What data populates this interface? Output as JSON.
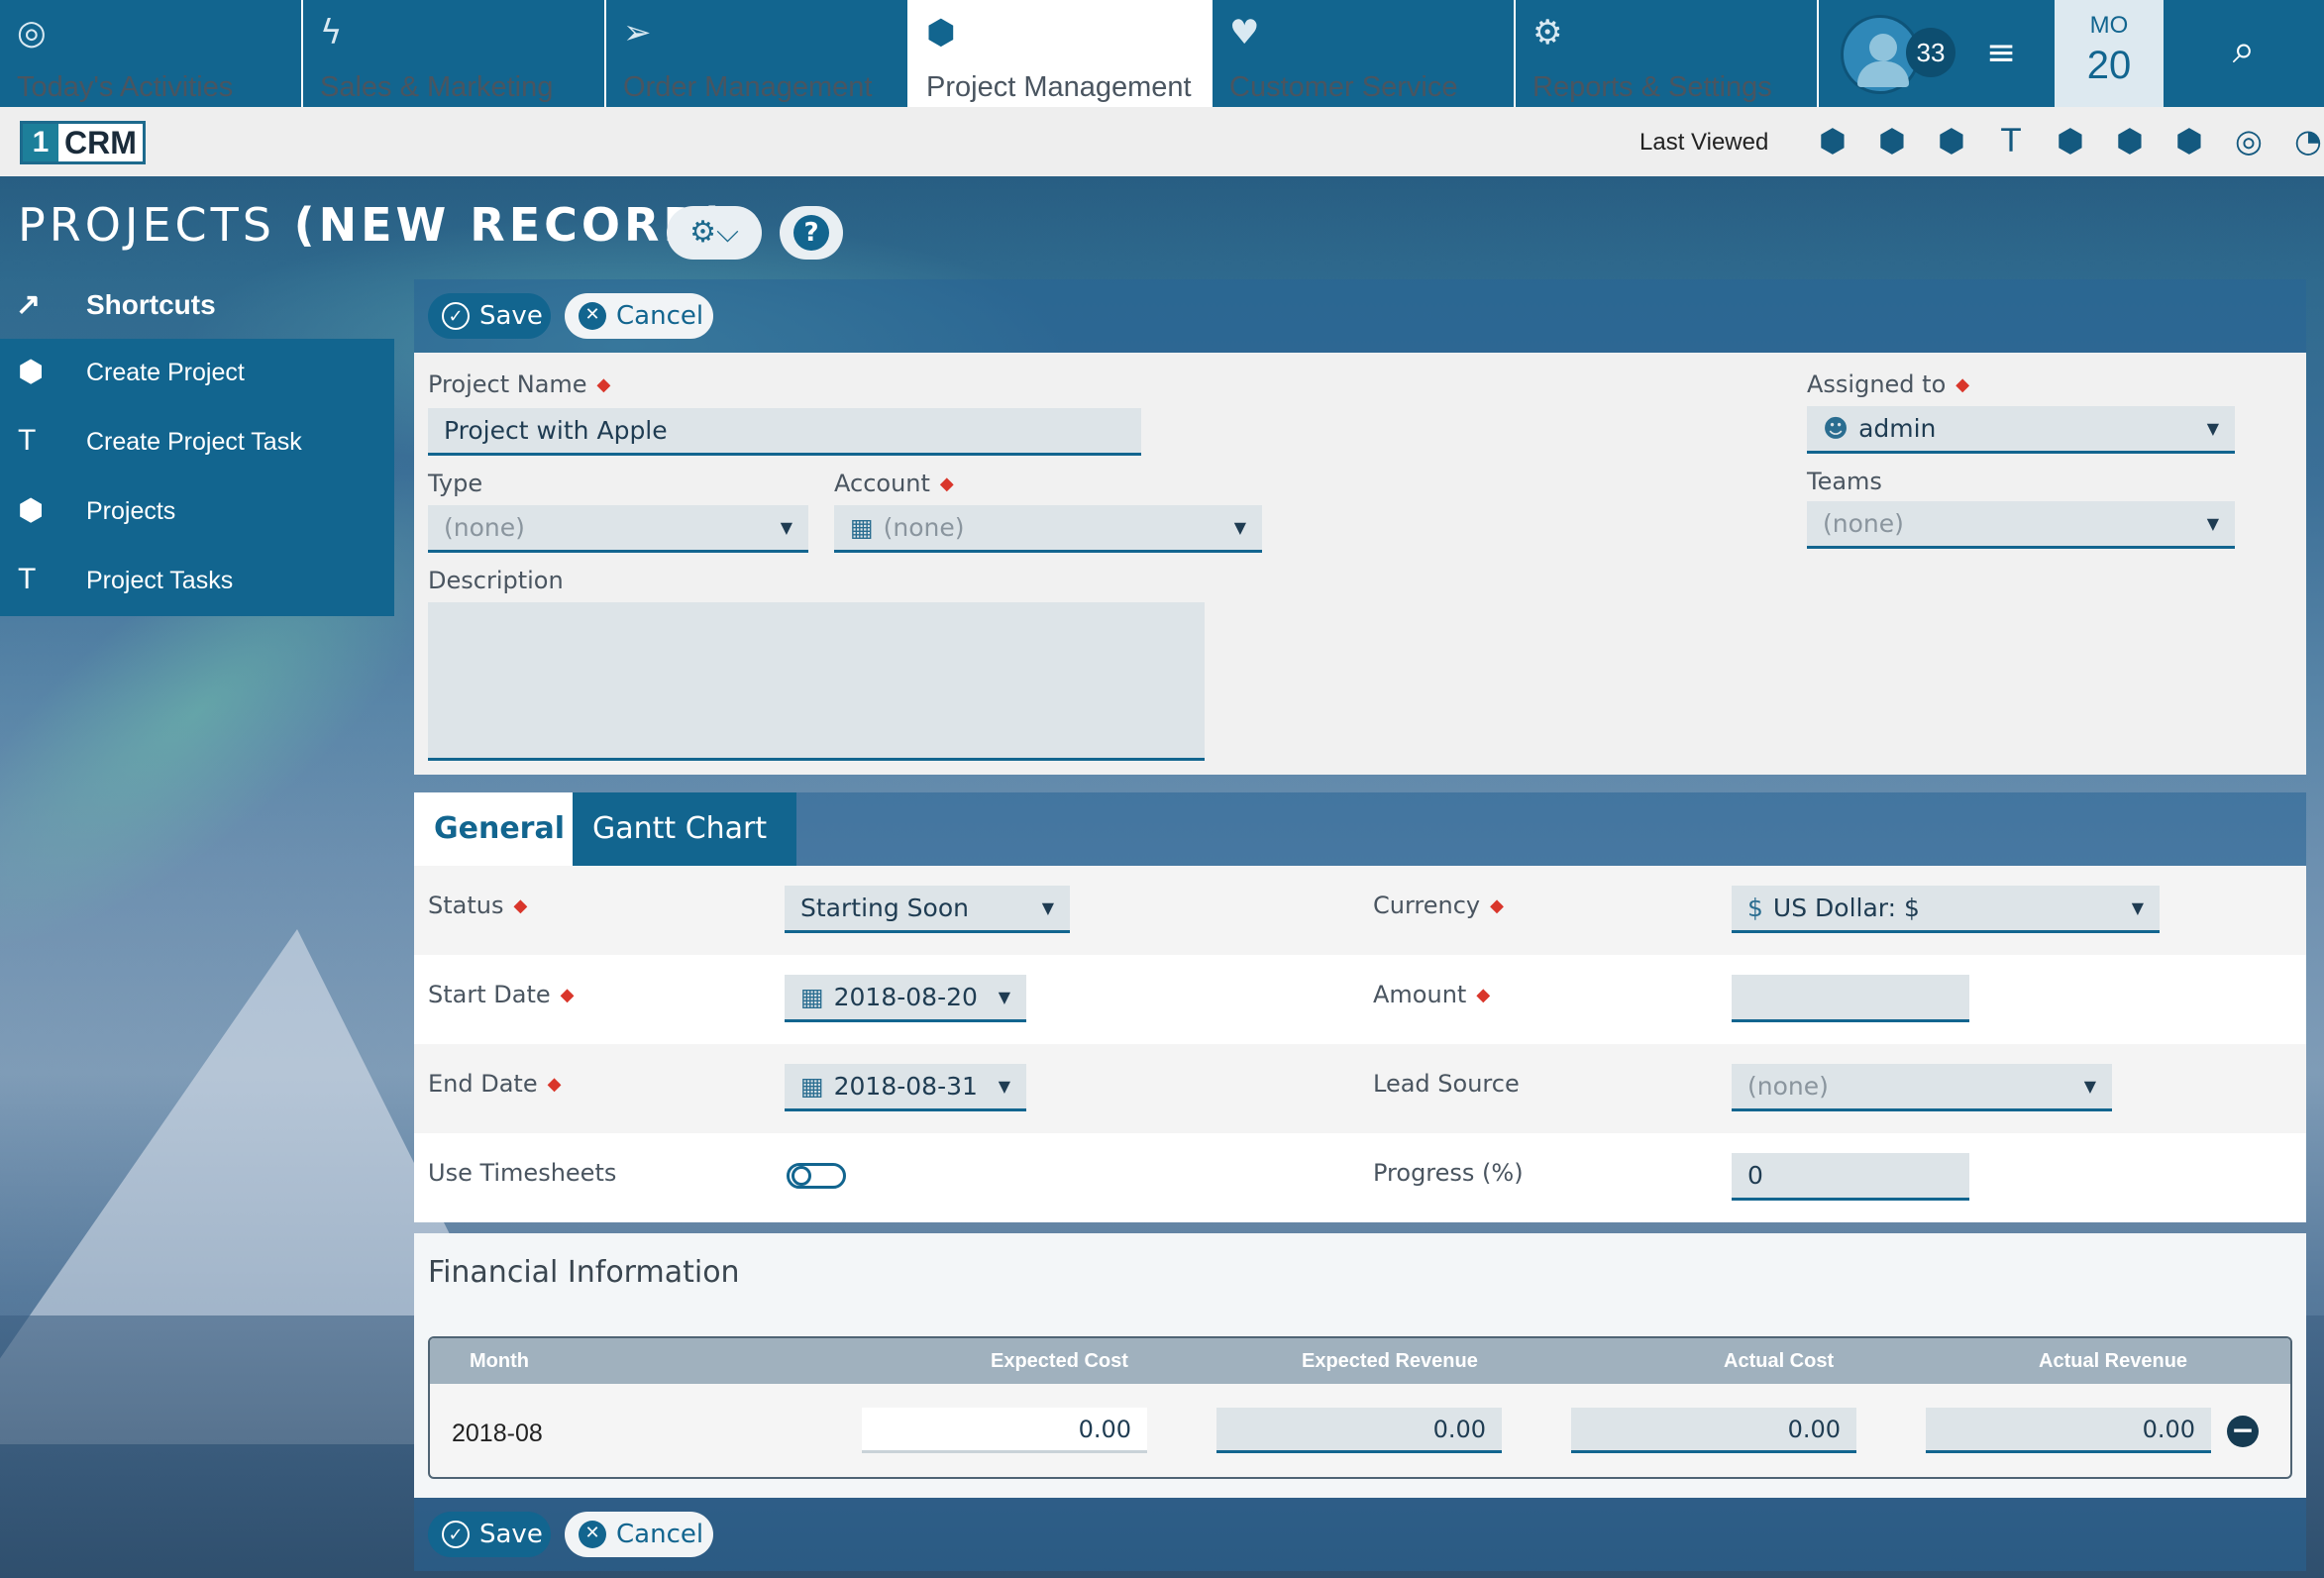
{
  "topnav": {
    "tabs": [
      {
        "label": "Today's Activities",
        "icon": "globe-icon",
        "glyph": "◎"
      },
      {
        "label": "Sales & Marketing",
        "icon": "bolt-icon",
        "glyph": "ϟ"
      },
      {
        "label": "Order Management",
        "icon": "paper-plane-icon",
        "glyph": "➢"
      },
      {
        "label": "Project Management",
        "icon": "cube-icon",
        "glyph": "⬢"
      },
      {
        "label": "Customer Service",
        "icon": "heart-icon",
        "glyph": "♥"
      },
      {
        "label": "Reports & Settings",
        "icon": "gear-icon",
        "glyph": "⚙"
      }
    ],
    "active_tab": "Project Management",
    "notification_count": "33",
    "calendar_month": "MO",
    "calendar_day": "20",
    "menu_glyph": "≡",
    "search_glyph": "⌕"
  },
  "secondbar": {
    "logo_one": "1",
    "logo_crm": "CRM",
    "last_viewed_label": "Last Viewed",
    "last_viewed_icons": [
      "cube-icon",
      "cube-icon",
      "cube-icon",
      "task-icon",
      "cube-icon",
      "cube-icon",
      "cube-icon",
      "soccer-ball-icon",
      "pie-icon"
    ],
    "last_viewed_glyphs": [
      "⬢",
      "⬢",
      "⬢",
      "T",
      "⬢",
      "⬢",
      "⬢",
      "◎",
      "◔"
    ]
  },
  "page": {
    "title_prefix": "PROJECTS",
    "title_suffix": "(NEW RECORD)",
    "gear_glyph": "⚙⌵",
    "help_glyph": "?"
  },
  "sidebar": {
    "header": "Shortcuts",
    "header_glyph": "↗",
    "items": [
      {
        "label": "Create Project",
        "icon": "cube-icon",
        "glyph": "⬢"
      },
      {
        "label": "Create Project Task",
        "icon": "task-icon",
        "glyph": "T"
      },
      {
        "label": "Projects",
        "icon": "cube-icon",
        "glyph": "⬢"
      },
      {
        "label": "Project Tasks",
        "icon": "task-icon",
        "glyph": "T"
      }
    ]
  },
  "actions": {
    "save_label": "Save",
    "cancel_label": "Cancel",
    "save_glyph": "✓",
    "cancel_glyph": "✕"
  },
  "form": {
    "project_name_label": "Project Name",
    "project_name_value": "Project with Apple",
    "assigned_to_label": "Assigned to",
    "assigned_to_value": "admin",
    "type_label": "Type",
    "type_value": "(none)",
    "account_label": "Account",
    "account_value": "(none)",
    "teams_label": "Teams",
    "teams_value": "(none)",
    "description_label": "Description",
    "description_value": ""
  },
  "tabs": {
    "general": "General",
    "gantt": "Gantt Chart"
  },
  "general": {
    "status_label": "Status",
    "status_value": "Starting Soon",
    "currency_label": "Currency",
    "currency_value": "US Dollar: $",
    "start_date_label": "Start Date",
    "start_date_value": "2018-08-20",
    "amount_label": "Amount",
    "amount_value": "",
    "end_date_label": "End Date",
    "end_date_value": "2018-08-31",
    "lead_source_label": "Lead Source",
    "lead_source_value": "(none)",
    "use_timesheets_label": "Use Timesheets",
    "use_timesheets_on": false,
    "progress_label": "Progress (%)",
    "progress_value": "0"
  },
  "financial": {
    "title": "Financial Information",
    "columns": [
      "Month",
      "Expected Cost",
      "Expected Revenue",
      "Actual Cost",
      "Actual Revenue"
    ],
    "rows": [
      {
        "month": "2018-08",
        "expected_cost": "0.00",
        "expected_revenue": "0.00",
        "actual_cost": "0.00",
        "actual_revenue": "0.00"
      }
    ]
  },
  "colors": {
    "primary": "#12658f",
    "required": "#d9362b"
  }
}
